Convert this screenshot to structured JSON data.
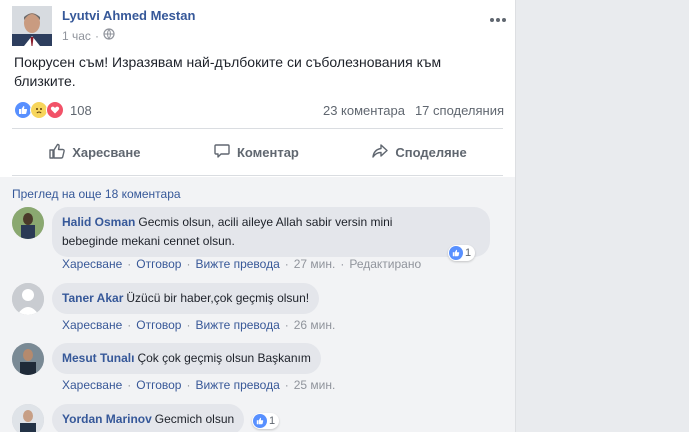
{
  "post": {
    "author": "Lyutvi Ahmed Mestan",
    "time": "1 час",
    "separator": "·",
    "text_line1": "Покрусен съм! Изразявам най-дълбоките си съболезнования към",
    "text_line2": "близките.",
    "reaction_count": "108",
    "comments_count": "23 коментара",
    "shares_count": "17 споделяния"
  },
  "actions": {
    "like": "Харесване",
    "comment": "Коментар",
    "share": "Споделяне"
  },
  "comments_section": {
    "view_more": "Преглед на още 18 коментара",
    "comments": [
      {
        "name": "Halid Osman",
        "text_line1": "Gecmis olsun, acili aileye Allah sabir versin mini",
        "text_line2": "bebeginde mekani cennet olsun.",
        "like": "Харесване",
        "reply": "Отговор",
        "translate": "Вижте превода",
        "time": "27 мин.",
        "edited": "Редактирано",
        "reaction_count": "1"
      },
      {
        "name": "Taner Akar",
        "text_line1": "Üzücü bir haber,çok geçmiş olsun!",
        "like": "Харесване",
        "reply": "Отговор",
        "translate": "Вижте превода",
        "time": "26 мин."
      },
      {
        "name": "Mesut Tunalı",
        "text_line1": "Çok çok geçmiş olsun Başkanım",
        "like": "Харесване",
        "reply": "Отговор",
        "translate": "Вижте превода",
        "time": "25 мин."
      },
      {
        "name": "Yordan Marinov",
        "text_line1": "Gecmich olsun",
        "reaction_count": "1"
      }
    ]
  },
  "icons": {
    "globe": "globe-icon",
    "more": "more-horizontal-icon",
    "like": "thumbs-up-icon",
    "comment": "speech-bubble-icon",
    "share": "share-arrow-icon"
  },
  "colors": {
    "link": "#365899",
    "like_blue": "#5890ff",
    "love_red": "#f25268",
    "sad_yellow": "#f7d55b"
  }
}
